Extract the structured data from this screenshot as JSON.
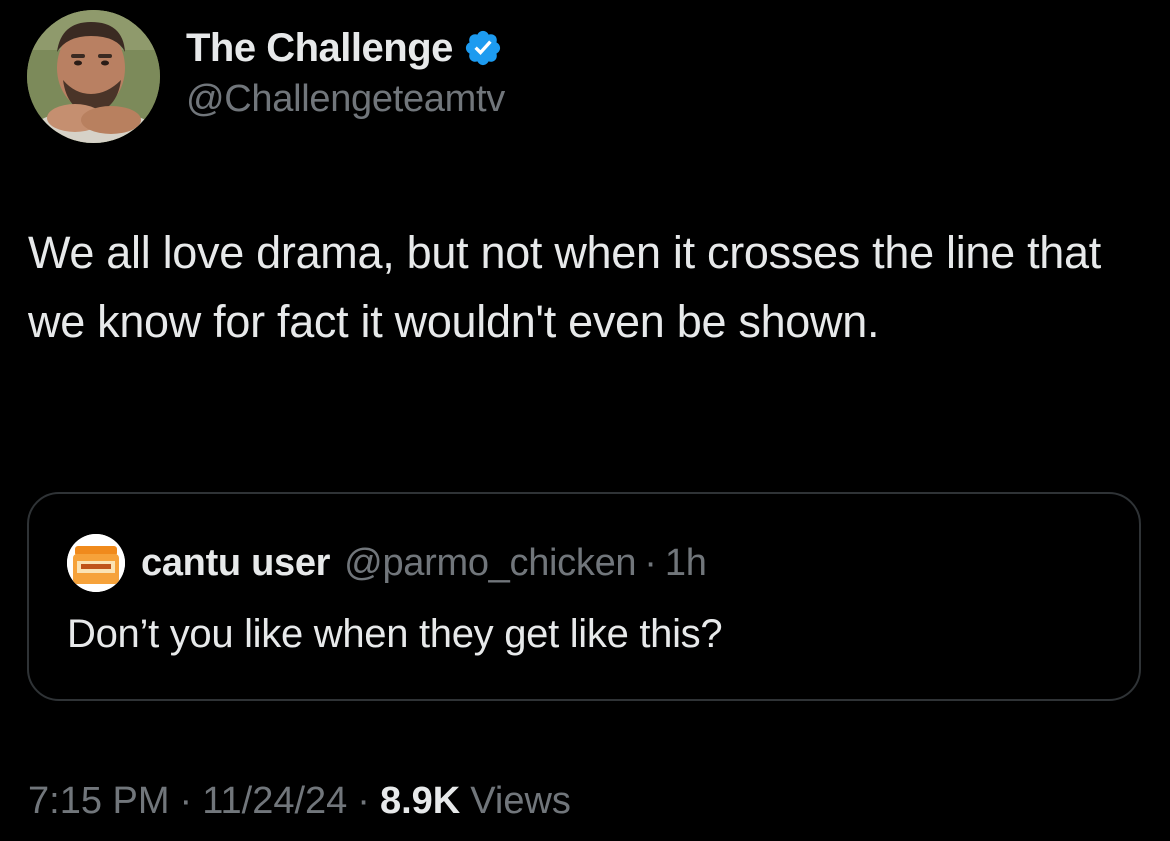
{
  "author": {
    "display_name": "The Challenge",
    "handle": "@Challengeteamtv",
    "verified": true,
    "avatar_icon": "man-portrait-avatar"
  },
  "tweet": {
    "text": "We all love drama, but not when it crosses the line that we know for fact it wouldn't even be shown."
  },
  "quoted_tweet": {
    "display_name": "cantu user",
    "handle": "@parmo_chicken",
    "separator": "·",
    "time": "1h",
    "text": "Don’t you like when they get like this?",
    "avatar_icon": "cantu-jar-avatar"
  },
  "meta": {
    "time": "7:15 PM",
    "date": "11/24/24",
    "separator": "·",
    "views_count": "8.9K",
    "views_label": "Views"
  },
  "colors": {
    "background": "#000000",
    "primary_text": "#e7e9ea",
    "secondary_text": "#71767b",
    "border": "#2f3336",
    "verified_blue": "#1d9bf0"
  }
}
